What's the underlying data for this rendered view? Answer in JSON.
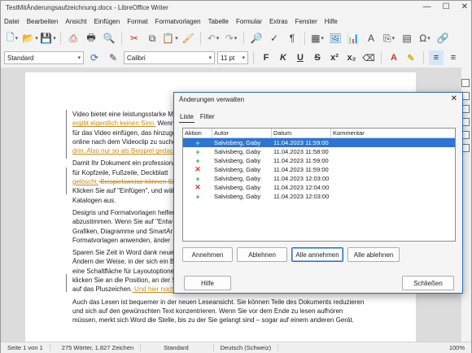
{
  "window": {
    "title": "TestMitÄnderungsaufzeichnung.docx - LibreOffice Writer",
    "controls": [
      "—",
      "☐",
      "✕"
    ]
  },
  "menu": [
    "Datei",
    "Bearbeiten",
    "Ansicht",
    "Einfügen",
    "Format",
    "Formatvorlagen",
    "Tabelle",
    "Formular",
    "Extras",
    "Fenster",
    "Hilfe"
  ],
  "formatting": {
    "paragraph_style": "Standard",
    "font_name": "Calibri",
    "font_size": "11 pt"
  },
  "document": {
    "paragraphs": [
      {
        "text": "Video bietet eine leistungsstarke M",
        "ins": "ergibt eigentlich keinen Sinn.",
        "tail": " Wenn"
      },
      {
        "text": "für das Video einfügen, das hinzuge"
      },
      {
        "text": "online nach dem Videoclip zu suche"
      },
      {
        "ins": "drin. Also nur so als Beispiel gedach"
      },
      {
        "text": "Damit Ihr Dokument ein professiona"
      },
      {
        "text": "für Kopfzeile, Fußzeile, Deckblatt"
      },
      {
        "ins": "gelöscht.",
        "del": " Beispielsweise können Si"
      },
      {
        "text": "Klicken Sie auf \"Einfügen\", und wäh"
      },
      {
        "text": "Katalogen aus."
      },
      {
        "text": "Designs und Formatvorlagen helfer"
      },
      {
        "text": "abzustimmen. Wenn Sie auf \"Entw"
      },
      {
        "text": "Grafiken, Diagramme und SmartAr"
      },
      {
        "text": "Formatvorlagen anwenden, änder"
      },
      {
        "text": "Sparen Sie Zeit in Word dank neuer"
      },
      {
        "text": "Ändern der Weise, in der sich ein B"
      },
      {
        "text": "eine Schaltfläche für Layoutoptione"
      },
      {
        "text": "klicken Sie an die Position, an der S"
      },
      {
        "text": "auf das Pluszeichen.",
        "ins": " Und hier noch"
      },
      {
        "text": "Auch das Lesen ist bequemer in der neuen Leseansicht. Sie können Teile des Dokuments reduzieren"
      },
      {
        "text": "und sich auf den gewünschten Text konzentrieren. Wenn Sie vor dem Ende zu lesen aufhören"
      },
      {
        "text": "müssen, merkt sich Word die Stelle, bis zu der Sie gelangt sind – sogar auf einem anderen Gerät."
      }
    ]
  },
  "dialog": {
    "title": "Änderungen verwalten",
    "tabs": [
      "Liste",
      "Filter"
    ],
    "columns": [
      "Aktion",
      "Autor",
      "Datum",
      "Kommentar"
    ],
    "rows": [
      {
        "action": "+",
        "type": "insert",
        "author": "Salvisberg, Gaby",
        "date": "11.04.2023 11:59:00",
        "comment": "",
        "selected": true
      },
      {
        "action": "+",
        "type": "insert",
        "author": "Salvisberg, Gaby",
        "date": "11.04.2023 11:58:00",
        "comment": "",
        "selected": false
      },
      {
        "action": "+",
        "type": "insert",
        "author": "Salvisberg, Gaby",
        "date": "11.04.2023 11:59:00",
        "comment": "",
        "selected": false
      },
      {
        "action": "✕",
        "type": "delete",
        "author": "Salvisberg, Gaby",
        "date": "11.04.2023 11:59:00",
        "comment": "",
        "selected": false
      },
      {
        "action": "+",
        "type": "insert",
        "author": "Salvisberg, Gaby",
        "date": "11.04.2023 12:03:00",
        "comment": "",
        "selected": false
      },
      {
        "action": "✕",
        "type": "delete",
        "author": "Salvisberg, Gaby",
        "date": "11.04.2023 12:04:00",
        "comment": "",
        "selected": false
      },
      {
        "action": "+",
        "type": "insert",
        "author": "Salvisberg, Gaby",
        "date": "11.04.2023 12:03:00",
        "comment": "",
        "selected": false
      }
    ],
    "buttons": {
      "accept": "Annehmen",
      "reject": "Ablehnen",
      "accept_all": "Alle annehmen",
      "reject_all": "Alle ablehnen",
      "help": "Hilfe",
      "close": "Schließen"
    }
  },
  "status": {
    "page": "Seite 1 von 1",
    "words": "275 Wörter, 1.827 Zeichen",
    "style": "Standard",
    "language": "Deutsch (Schweiz)",
    "zoom": "100%"
  },
  "colors": {
    "accent": "#2f74d0",
    "change_tracked": "#c78a1a",
    "insert_mark": "#28a745",
    "delete_mark": "#d33333"
  }
}
